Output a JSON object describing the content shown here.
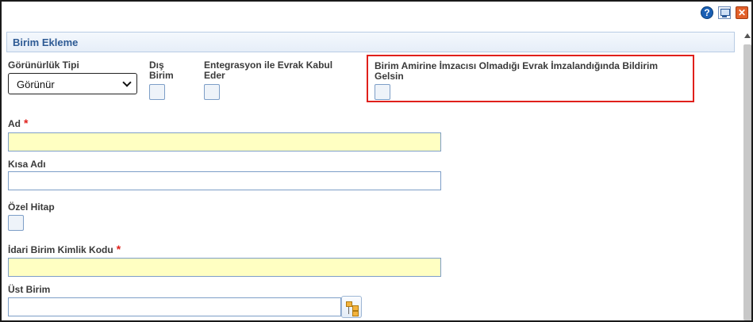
{
  "window": {
    "help_icon": "help-icon",
    "monitor_icon": "monitor-icon",
    "close_icon": "close-icon"
  },
  "panel": {
    "title": "Birim Ekleme"
  },
  "fields": {
    "visibility_type": {
      "label": "Görünürlük Tipi",
      "value": "Görünür"
    },
    "external_unit": {
      "label_line1": "Dış",
      "label_line2": "Birim"
    },
    "integration": {
      "label_line1": "Entegrasyon ile Evrak Kabul",
      "label_line2": "Eder"
    },
    "notify": {
      "label_line1": "Birim Amirine İmzacısı Olmadığı Evrak İmzalandığında Bildirim",
      "label_line2": "Gelsin"
    },
    "name": {
      "label": "Ad",
      "required": "*",
      "value": ""
    },
    "short_name": {
      "label": "Kısa Adı",
      "value": ""
    },
    "special_address": {
      "label": "Özel Hitap"
    },
    "admin_unit_id": {
      "label": "İdari Birim Kimlik Kodu",
      "required": "*",
      "value": ""
    },
    "parent_unit": {
      "label": "Üst Birim",
      "value": ""
    }
  },
  "colors": {
    "header_text": "#2d5a94",
    "required": "#e0201b",
    "required_input_bg": "#ffffc2",
    "highlight_border": "#e0201b"
  }
}
